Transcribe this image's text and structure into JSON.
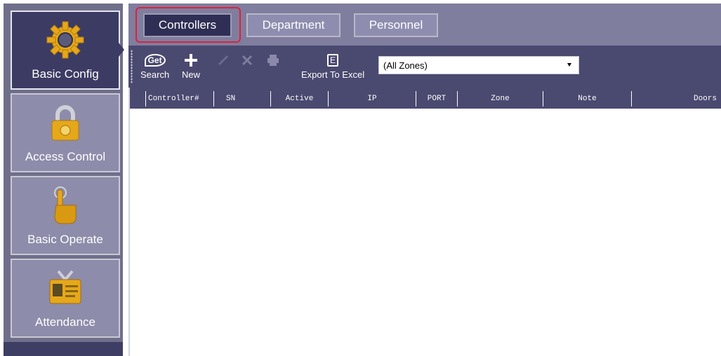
{
  "sidebar": {
    "items": [
      {
        "label": "Basic Config",
        "icon": "gear-icon"
      },
      {
        "label": "Access Control",
        "icon": "lock-icon"
      },
      {
        "label": "Basic Operate",
        "icon": "pointing-hand-icon"
      },
      {
        "label": "Attendance",
        "icon": "id-badge-icon"
      }
    ],
    "active_index": 0
  },
  "tabs": [
    {
      "label": "Controllers"
    },
    {
      "label": "Department"
    },
    {
      "label": "Personnel"
    }
  ],
  "toolbar": {
    "search_label": "Search",
    "search_icon_text": "Get",
    "new_label": "New",
    "export_label": "Export To Excel",
    "export_icon_text": "E",
    "zone_value": "(All Zones)"
  },
  "grid": {
    "columns": [
      "Controller#",
      "SN",
      "Active",
      "IP",
      "PORT",
      "Zone",
      "Note",
      "Doors"
    ],
    "rows": []
  },
  "colors": {
    "sidebar_bg": "#6f6f8c",
    "active_bg": "#3c3b63",
    "toolbar_bg": "#4a4970",
    "tabbar_bg": "#7f7e9e",
    "highlight": "#e0203a"
  }
}
